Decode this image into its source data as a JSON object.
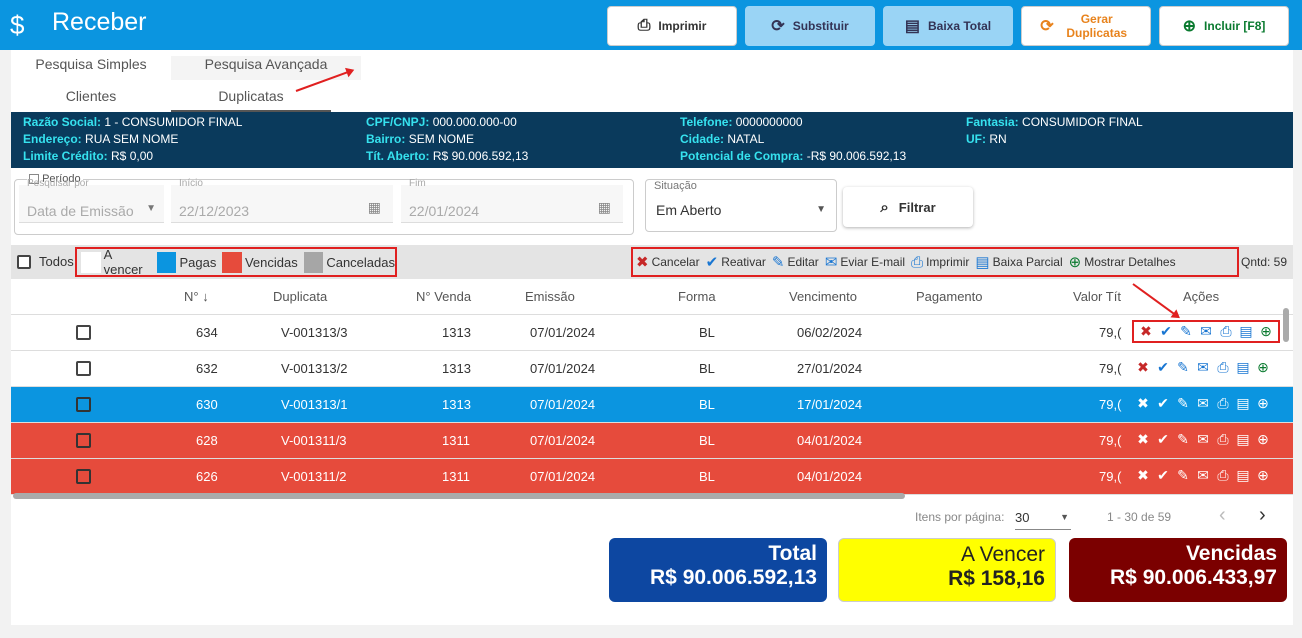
{
  "header": {
    "title": "Receber",
    "buttons": [
      {
        "label": "Imprimir",
        "icon": "printer-icon"
      },
      {
        "label": "Substituir",
        "icon": "refresh-icon"
      },
      {
        "label": "Baixa Total",
        "icon": "document-icon"
      },
      {
        "label": "Gerar Duplicatas",
        "icon": "refresh-orange-icon"
      },
      {
        "label": "Incluir [F8]",
        "icon": "plus-circle-icon"
      }
    ]
  },
  "tabs": {
    "search": [
      "Pesquisa Simples",
      "Pesquisa Avançada"
    ],
    "sub": [
      "Clientes",
      "Duplicatas"
    ]
  },
  "client": {
    "razao_k": "Razão Social:",
    "razao": "1 - CONSUMIDOR FINAL",
    "end_k": "Endereço:",
    "end": "RUA SEM NOME",
    "lim_k": "Limite Crédito:",
    "lim": "R$ 0,00",
    "cpf_k": "CPF/CNPJ:",
    "cpf": "000.000.000-00",
    "bairro_k": "Bairro:",
    "bairro": "SEM NOME",
    "tit_k": "Tít. Aberto:",
    "tit": "R$ 90.006.592,13",
    "tel_k": "Telefone:",
    "tel": "0000000000",
    "cid_k": "Cidade:",
    "cid": "NATAL",
    "pot_k": "Potencial de Compra:",
    "pot": "-R$ 90.006.592,13",
    "fan_k": "Fantasia:",
    "fan": "CONSUMIDOR FINAL",
    "uf_k": "UF:",
    "uf": "RN"
  },
  "filters": {
    "pesquisar_por_label": "Pesquisar por",
    "pesquisar_por": "Data de Emissão",
    "periodo": "Período",
    "inicio_label": "Início",
    "inicio": "22/12/2023",
    "fim_label": "Fim",
    "fim": "22/01/2024",
    "situacao_label": "Situação",
    "situacao": "Em Aberto",
    "filtrar": "Filtrar"
  },
  "legend": {
    "todos": "Todos",
    "items": [
      {
        "label": "A vencer",
        "color": "#ffffff"
      },
      {
        "label": "Pagas",
        "color": "#0b95e0"
      },
      {
        "label": "Vencidas",
        "color": "#e64b3c"
      },
      {
        "label": "Canceladas",
        "color": "#a6a6a6"
      }
    ]
  },
  "actions": [
    {
      "label": "Cancelar",
      "icon": "x-icon"
    },
    {
      "label": "Reativar",
      "icon": "check-icon"
    },
    {
      "label": "Editar",
      "icon": "edit-icon"
    },
    {
      "label": "Eviar E-mail",
      "icon": "mail-icon"
    },
    {
      "label": "Imprimir",
      "icon": "printer-icon"
    },
    {
      "label": "Baixa Parcial",
      "icon": "document-icon"
    },
    {
      "label": "Mostrar Detalhes",
      "icon": "plus-circle-icon"
    }
  ],
  "qntd": "Qntd: 59",
  "columns": [
    "N°",
    "Duplicata",
    "N° Venda",
    "Emissão",
    "Forma",
    "Vencimento",
    "Pagamento",
    "Valor Tít",
    "Ações"
  ],
  "rows": [
    {
      "n": "634",
      "dup": "V-001313/3",
      "venda": "1313",
      "emissao": "07/01/2024",
      "forma": "BL",
      "venc": "06/02/2024",
      "pag": "",
      "valor": "79,(",
      "status": "a-vencer"
    },
    {
      "n": "632",
      "dup": "V-001313/2",
      "venda": "1313",
      "emissao": "07/01/2024",
      "forma": "BL",
      "venc": "27/01/2024",
      "pag": "",
      "valor": "79,(",
      "status": "a-vencer"
    },
    {
      "n": "630",
      "dup": "V-001313/1",
      "venda": "1313",
      "emissao": "07/01/2024",
      "forma": "BL",
      "venc": "17/01/2024",
      "pag": "",
      "valor": "79,(",
      "status": "paga"
    },
    {
      "n": "628",
      "dup": "V-001311/3",
      "venda": "1311",
      "emissao": "07/01/2024",
      "forma": "BL",
      "venc": "04/01/2024",
      "pag": "",
      "valor": "79,(",
      "status": "vencida"
    },
    {
      "n": "626",
      "dup": "V-001311/2",
      "venda": "1311",
      "emissao": "07/01/2024",
      "forma": "BL",
      "venc": "04/01/2024",
      "pag": "",
      "valor": "79,(",
      "status": "vencida"
    }
  ],
  "pagination": {
    "label": "Itens por página:",
    "per_page": "30",
    "range": "1 - 30 de 59"
  },
  "totals": [
    {
      "label": "Total",
      "value": "R$ 90.006.592,13",
      "bg": "#0d47a1",
      "fg": "#ffffff"
    },
    {
      "label": "A Vencer",
      "value": "R$ 158,16",
      "bg": "#ffff00",
      "fg": "#222222"
    },
    {
      "label": "Vencidas",
      "value": "R$ 90.006.433,97",
      "bg": "#7b0000",
      "fg": "#ffffff"
    }
  ]
}
